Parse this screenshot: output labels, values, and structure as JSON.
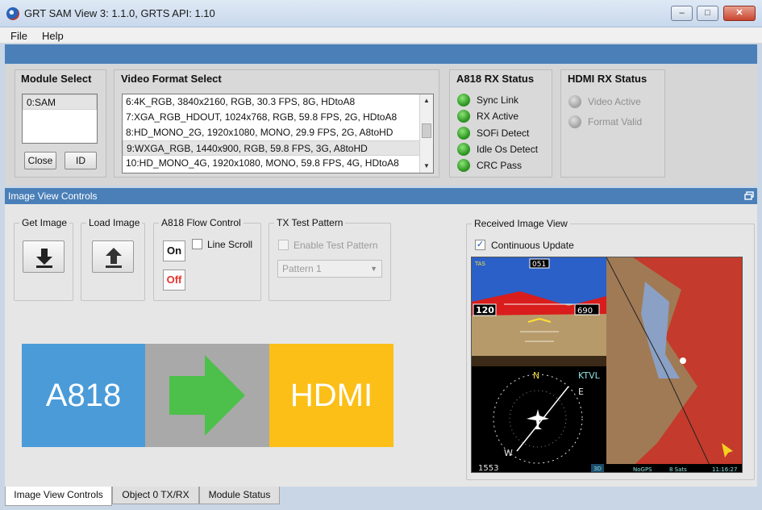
{
  "window": {
    "title": "GRT SAM View 3: 1.1.0, GRTS API: 1.10",
    "controls": {
      "minimize": "–",
      "maximize": "□",
      "close": "✕"
    }
  },
  "menu": {
    "file": "File",
    "help": "Help"
  },
  "module_select": {
    "title": "Module Select",
    "items": [
      "0:SAM"
    ],
    "close_label": "Close",
    "id_label": "ID"
  },
  "video_format": {
    "title": "Video Format Select",
    "items": [
      "6:4K_RGB, 3840x2160, RGB, 30.3 FPS, 8G, HDtoA8",
      "7:XGA_RGB_HDOUT, 1024x768, RGB, 59.8 FPS, 2G, HDtoA8",
      "8:HD_MONO_2G, 1920x1080, MONO, 29.9 FPS, 2G, A8toHD",
      "9:WXGA_RGB, 1440x900, RGB, 59.8 FPS, 3G, A8toHD",
      "10:HD_MONO_4G, 1920x1080, MONO, 59.8 FPS, 4G, HDtoA8"
    ],
    "selected_index": 3
  },
  "a818_status": {
    "title": "A818 RX Status",
    "items": [
      "Sync Link",
      "RX Active",
      "SOFi Detect",
      "Idle Os Detect",
      "CRC Pass"
    ]
  },
  "hdmi_status": {
    "title": "HDMI RX Status",
    "items": [
      "Video Active",
      "Format Valid"
    ]
  },
  "image_view_controls": {
    "header": "Image View Controls",
    "get_image": "Get Image",
    "load_image": "Load Image",
    "flow_control": {
      "title": "A818 Flow Control",
      "on": "On",
      "off": "Off",
      "line_scroll": "Line Scroll"
    },
    "test_pattern": {
      "title": "TX Test Pattern",
      "enable": "Enable Test Pattern",
      "pattern": "Pattern 1"
    },
    "flow": {
      "source": "A818",
      "target": "HDMI"
    },
    "received": {
      "title": "Received Image View",
      "continuous": "Continuous Update"
    }
  },
  "avionics": {
    "speed": "120",
    "altitude": "690",
    "heading": "051",
    "tas": "TAS",
    "compass": [
      "N",
      "E",
      "W"
    ],
    "airport": "KTVL",
    "bottom_left": "1553",
    "nogps": "NoGPS",
    "sats": "8 Sats",
    "time": "11:16:27",
    "fix": "3D"
  },
  "tabs": [
    "Image View Controls",
    "Object 0 TX/RX",
    "Module Status"
  ],
  "colors": {
    "a818": "#4a9bd8",
    "arrow_bg": "#a9a9a9",
    "arrow": "#4cc04a",
    "hdmi": "#fbbf17",
    "accent_blue": "#4a7fb8",
    "off_red": "#e8322c"
  }
}
